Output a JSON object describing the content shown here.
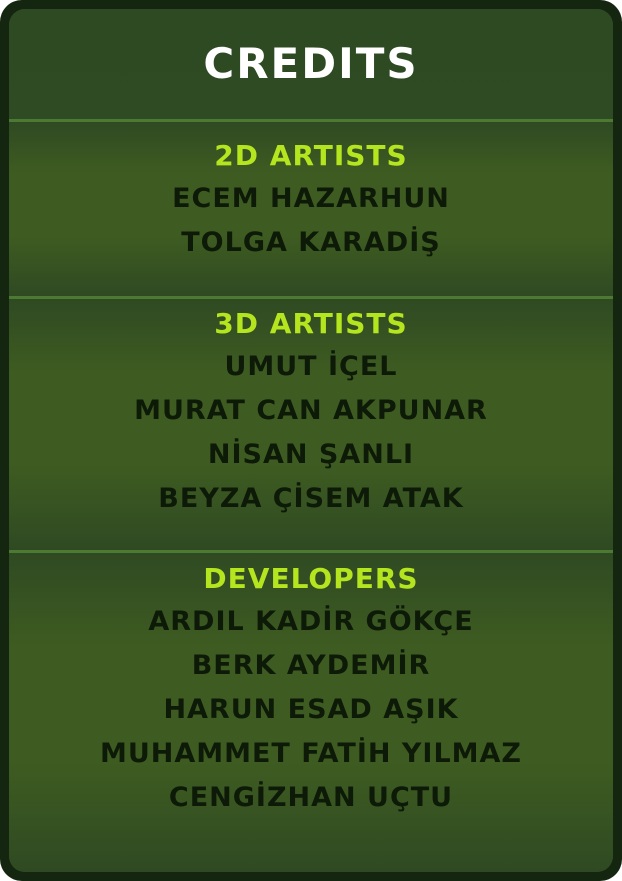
{
  "title": "CREDITS",
  "colors": {
    "frame": "#142510",
    "panel": "#2f4a22",
    "divider": "#4d7a33",
    "heading": "#b4e51e",
    "name": "#0d1a08",
    "title": "#ffffff"
  },
  "sections": [
    {
      "heading": "2D ARTISTS",
      "names": [
        "ECEM HAZARHUN",
        "TOLGA KARADİŞ"
      ]
    },
    {
      "heading": "3D ARTISTS",
      "names": [
        "UMUT İÇEL",
        "MURAT CAN AKPUNAR",
        "NİSAN ŞANLI",
        "BEYZA ÇİSEM ATAK"
      ]
    },
    {
      "heading": "DEVELOPERS",
      "names": [
        "ARDIL KADİR GÖKÇE",
        "BERK AYDEMİR",
        "HARUN ESAD AŞIK",
        "MUHAMMET FATİH YILMAZ",
        "CENGİZHAN UÇTU"
      ]
    }
  ]
}
